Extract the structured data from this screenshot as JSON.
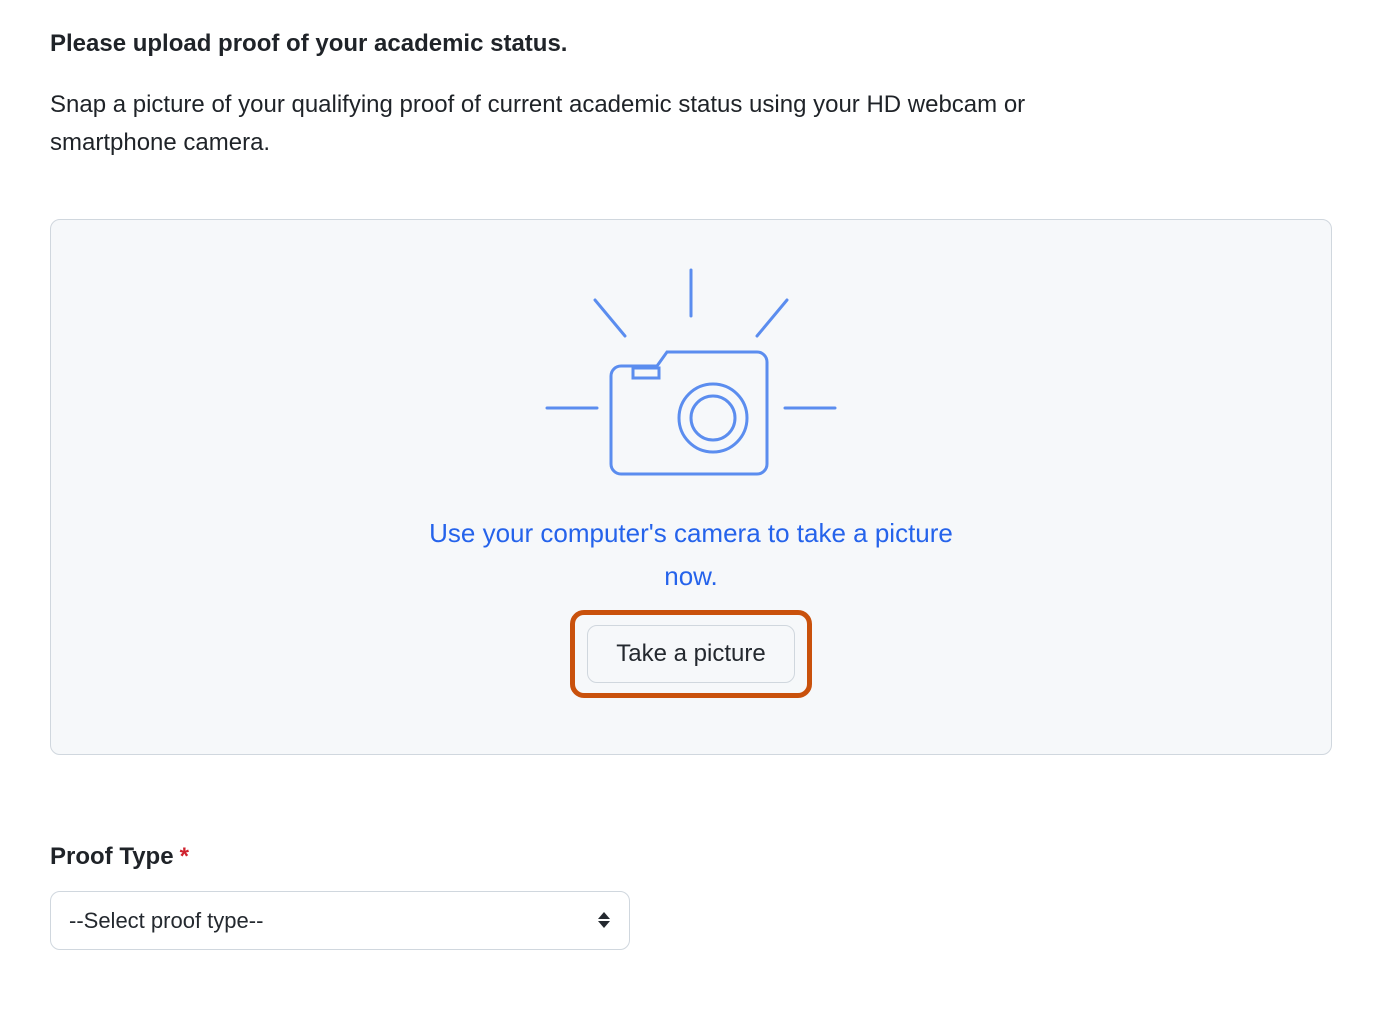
{
  "heading": "Please upload proof of your academic status.",
  "description": "Snap a picture of your qualifying proof of current academic status using your HD webcam or smartphone camera.",
  "upload_panel": {
    "prompt": "Use your computer's camera to take a picture now.",
    "button_label": "Take a picture"
  },
  "proof_type": {
    "label": "Proof Type",
    "required_mark": "*",
    "selected": "--Select proof type--"
  },
  "colors": {
    "panel_bg": "#f6f8fa",
    "panel_border": "#d0d7de",
    "accent_blue": "#2563eb",
    "highlight_orange": "#c9510c",
    "required_red": "#cf222e"
  }
}
